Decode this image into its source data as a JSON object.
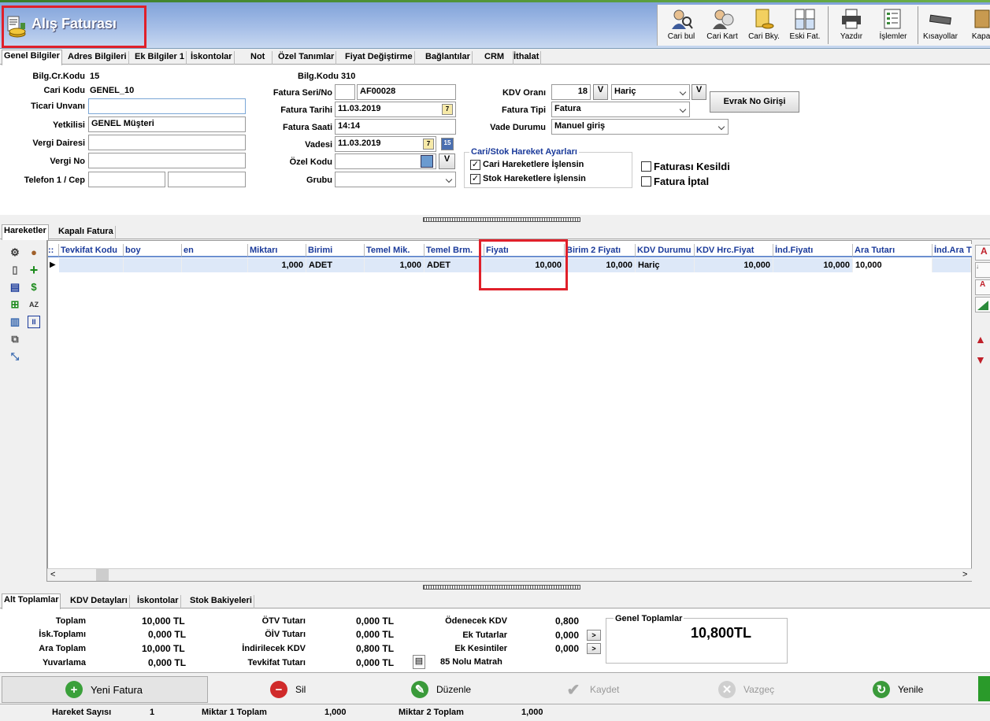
{
  "window": {
    "title": "Alış Faturası"
  },
  "toolbar": {
    "buttons": [
      {
        "label": "Cari bul",
        "icon": "person-search-icon"
      },
      {
        "label": "Cari Kart",
        "icon": "person-card-icon"
      },
      {
        "label": "Cari Bky.",
        "icon": "balance-icon"
      },
      {
        "label": "Eski Fat.",
        "icon": "old-invoices-icon"
      },
      {
        "label": "Yazdır",
        "icon": "printer-icon"
      },
      {
        "label": "İşlemler",
        "icon": "operations-icon"
      },
      {
        "label": "Kısayollar",
        "icon": "keyboard-icon"
      },
      {
        "label": "Kapat",
        "icon": "close-icon"
      }
    ]
  },
  "tabs_top": [
    "Genel Bilgiler",
    "Adres Bilgileri",
    "Ek Bilgiler 1",
    "İskontolar",
    "Not",
    "Özel Tanımlar",
    "Fiyat Değiştirme",
    "Bağlantılar",
    "CRM",
    "İthalat"
  ],
  "form": {
    "bilg_cr_kodu_label": "Bilg.Cr.Kodu",
    "bilg_cr_kodu_value": "15",
    "cari_kodu_label": "Cari Kodu",
    "cari_kodu_value": "GENEL_10",
    "ticari_unvani_label": "Ticari Unvanı",
    "ticari_unvani_value": "",
    "yetkilisi_label": "Yetkilisi",
    "yetkilisi_value": "GENEL Müşteri",
    "vergi_dairesi_label": "Vergi Dairesi",
    "vergi_dairesi_value": "",
    "vergi_no_label": "Vergi No",
    "vergi_no_value": "",
    "telefon_label": "Telefon 1 / Cep",
    "telefon1_value": "",
    "cep_value": "",
    "bilg_kodu_label": "Bilg.Kodu",
    "bilg_kodu_value": "310",
    "fatura_seri_label": "Fatura Seri/No",
    "fatura_seri_value": "",
    "fatura_no_value": "AF00028",
    "fatura_tarihi_label": "Fatura Tarihi",
    "fatura_tarihi_value": "11.03.2019",
    "fatura_saati_label": "Fatura Saati",
    "fatura_saati_value": "14:14",
    "vadesi_label": "Vadesi",
    "vadesi_value": "11.03.2019",
    "ozel_kodu_label": "Özel Kodu",
    "ozel_kodu_value": "",
    "grubu_label": "Grubu",
    "grubu_value": "",
    "kdv_orani_label": "KDV Oranı",
    "kdv_orani_value": "18",
    "kdv_mode_value": "Hariç",
    "v_label": "V",
    "fatura_tipi_label": "Fatura Tipi",
    "fatura_tipi_value": "Fatura",
    "vade_durumu_label": "Vade Durumu",
    "vade_durumu_value": "Manuel giriş",
    "evrak_button": "Evrak No Girişi",
    "calendar_day": "7",
    "calendar_alt_day": "15",
    "group_title": "Cari/Stok Hareket Ayarları",
    "cari_hareket_label": "Cari Hareketlere İşlensin",
    "cari_hareket_checked": true,
    "stok_hareket_label": "Stok Hareketlere İşlensin",
    "stok_hareket_checked": true,
    "faturasi_kesildi_label": "Faturası Kesildi",
    "faturasi_kesildi_checked": false,
    "fatura_iptal_label": "Fatura İptal",
    "fatura_iptal_checked": false
  },
  "tabs_mid": [
    "Hareketler",
    "Kapalı Fatura"
  ],
  "grid": {
    "columns": [
      "Tevkifat Kodu",
      "boy",
      "en",
      "Miktarı",
      "Birimi",
      "Temel Mik.",
      "Temel Brm.",
      "Fiyatı",
      "Birim 2 Fiyatı",
      "KDV Durumu",
      "KDV Hrc.Fiyat",
      "İnd.Fiyatı",
      "Ara Tutarı",
      "İnd.Ara T"
    ],
    "row": [
      "",
      "",
      "",
      "1,000",
      "ADET",
      "1,000",
      "ADET",
      "10,000",
      "10,000",
      "Hariç",
      "10,000",
      "10,000",
      "10,000",
      ""
    ],
    "scroll_left": "<",
    "scroll_right": ">"
  },
  "tabs_bottom": [
    "Alt Toplamlar",
    "KDV Detayları",
    "İskontolar",
    "Stok Bakiyeleri"
  ],
  "totals": {
    "toplam_label": "Toplam",
    "toplam_value": "10,000 TL",
    "isk_toplami_label": "İsk.Toplamı",
    "isk_toplami_value": "0,000 TL",
    "ara_toplam_label": "Ara Toplam",
    "ara_toplam_value": "10,000 TL",
    "yuvarlama_label": "Yuvarlama",
    "yuvarlama_value": "0,000 TL",
    "otv_label": "ÖTV Tutarı",
    "otv_value": "0,000 TL",
    "oiv_label": "ÖİV Tutarı",
    "oiv_value": "0,000 TL",
    "indirilecek_kdv_label": "İndirilecek KDV",
    "indirilecek_kdv_value": "0,800 TL",
    "tevkifat_label": "Tevkifat Tutarı",
    "tevkifat_value": "0,000 TL",
    "odenecek_kdv_label": "Ödenecek KDV",
    "odenecek_kdv_value": "0,800",
    "ek_tutarlar_label": "Ek Tutarlar",
    "ek_tutarlar_value": "0,000",
    "ek_kesintiler_label": "Ek Kesintiler",
    "ek_kesintiler_value": "0,000",
    "matrah_label": "85 Nolu Matrah",
    "genel_title": "Genel Toplamlar",
    "genel_value": "10,800TL"
  },
  "actions": {
    "yeni": "Yeni Fatura",
    "sil": "Sil",
    "duzenle": "Düzenle",
    "kaydet": "Kaydet",
    "vazgec": "Vazgeç",
    "yenile": "Yenile"
  },
  "status": {
    "hareket_label": "Hareket Sayısı",
    "hareket_value": "1",
    "miktar1_label": "Miktar 1 Toplam",
    "miktar1_value": "1,000",
    "miktar2_label": "Miktar 2 Toplam",
    "miktar2_value": "1,000"
  },
  "colors": {
    "accent_red": "#e0202a",
    "header_blue": "#7da0d8",
    "column_blue": "#1a3a9a"
  }
}
